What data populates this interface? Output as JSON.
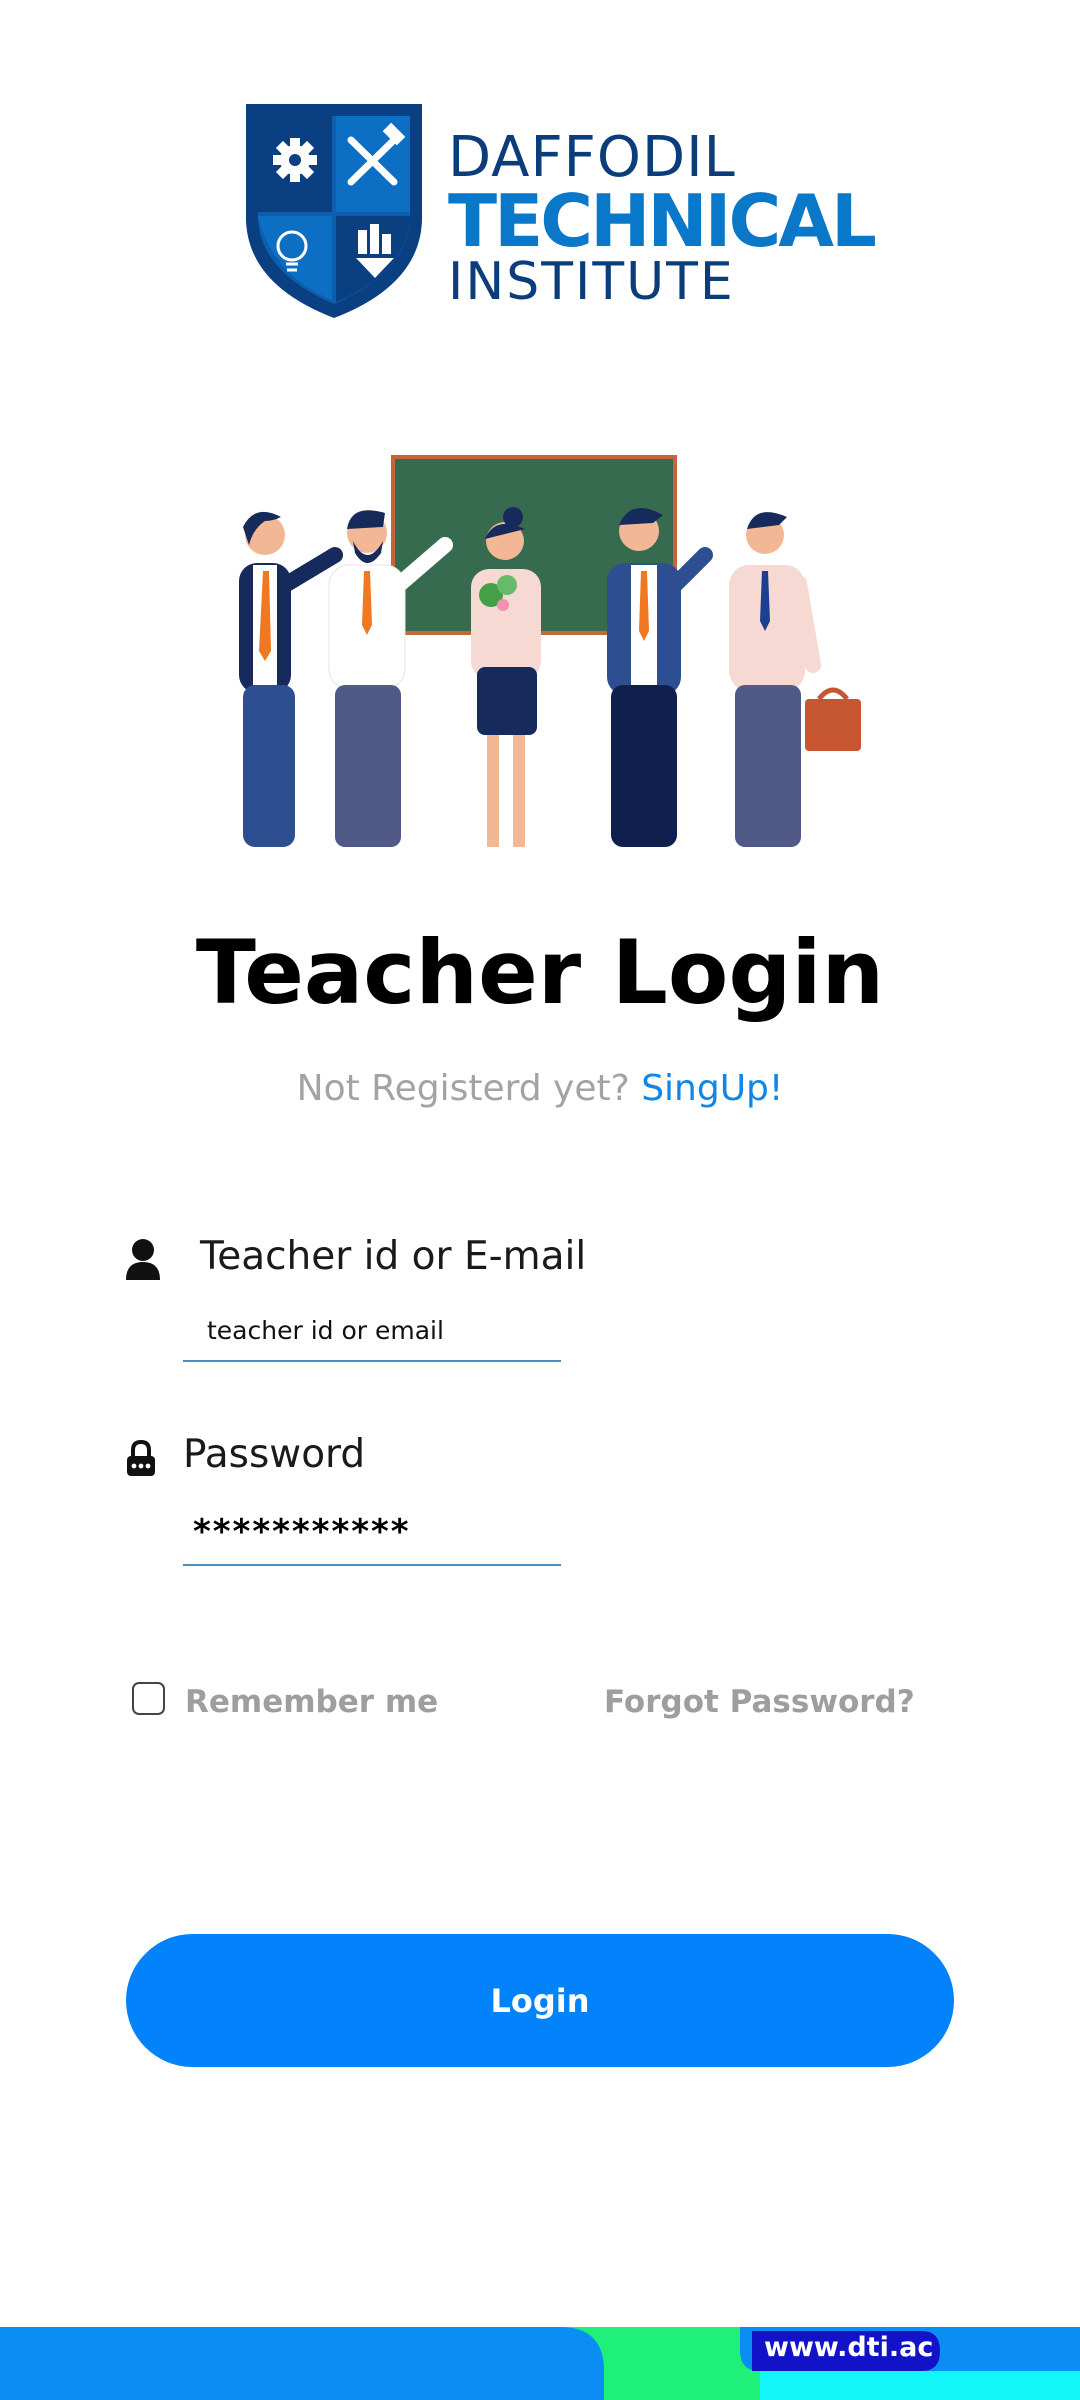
{
  "brand": {
    "line1": "DAFFODIL",
    "line2": "TECHNICAL",
    "line3": "INSTITUTE",
    "colors": {
      "navy": "#0b3d7a",
      "blue": "#0a78c8"
    }
  },
  "page": {
    "title": "Teacher Login",
    "subtitle_prefix": "Not Registerd yet?",
    "signup_link": "SingUp!"
  },
  "form": {
    "id_field": {
      "label": "Teacher id or E-mail",
      "placeholder": "teacher id or email",
      "icon": "user-icon"
    },
    "password_field": {
      "label": "Password",
      "value": "***********",
      "icon": "lock-icon"
    },
    "remember_label": "Remember me",
    "remember_checked": false,
    "forgot_label": "Forgot Password?",
    "login_label": "Login"
  },
  "footer": {
    "url": "www.dti.ac"
  },
  "theme": {
    "accent": "#0282fb",
    "link": "#1186e6",
    "muted": "#9e9e9e",
    "footer_blue": "#0a8ef4",
    "footer_green": "#1ef07a",
    "footer_cyan": "#12f6fa",
    "footer_navy": "#1212c8"
  }
}
